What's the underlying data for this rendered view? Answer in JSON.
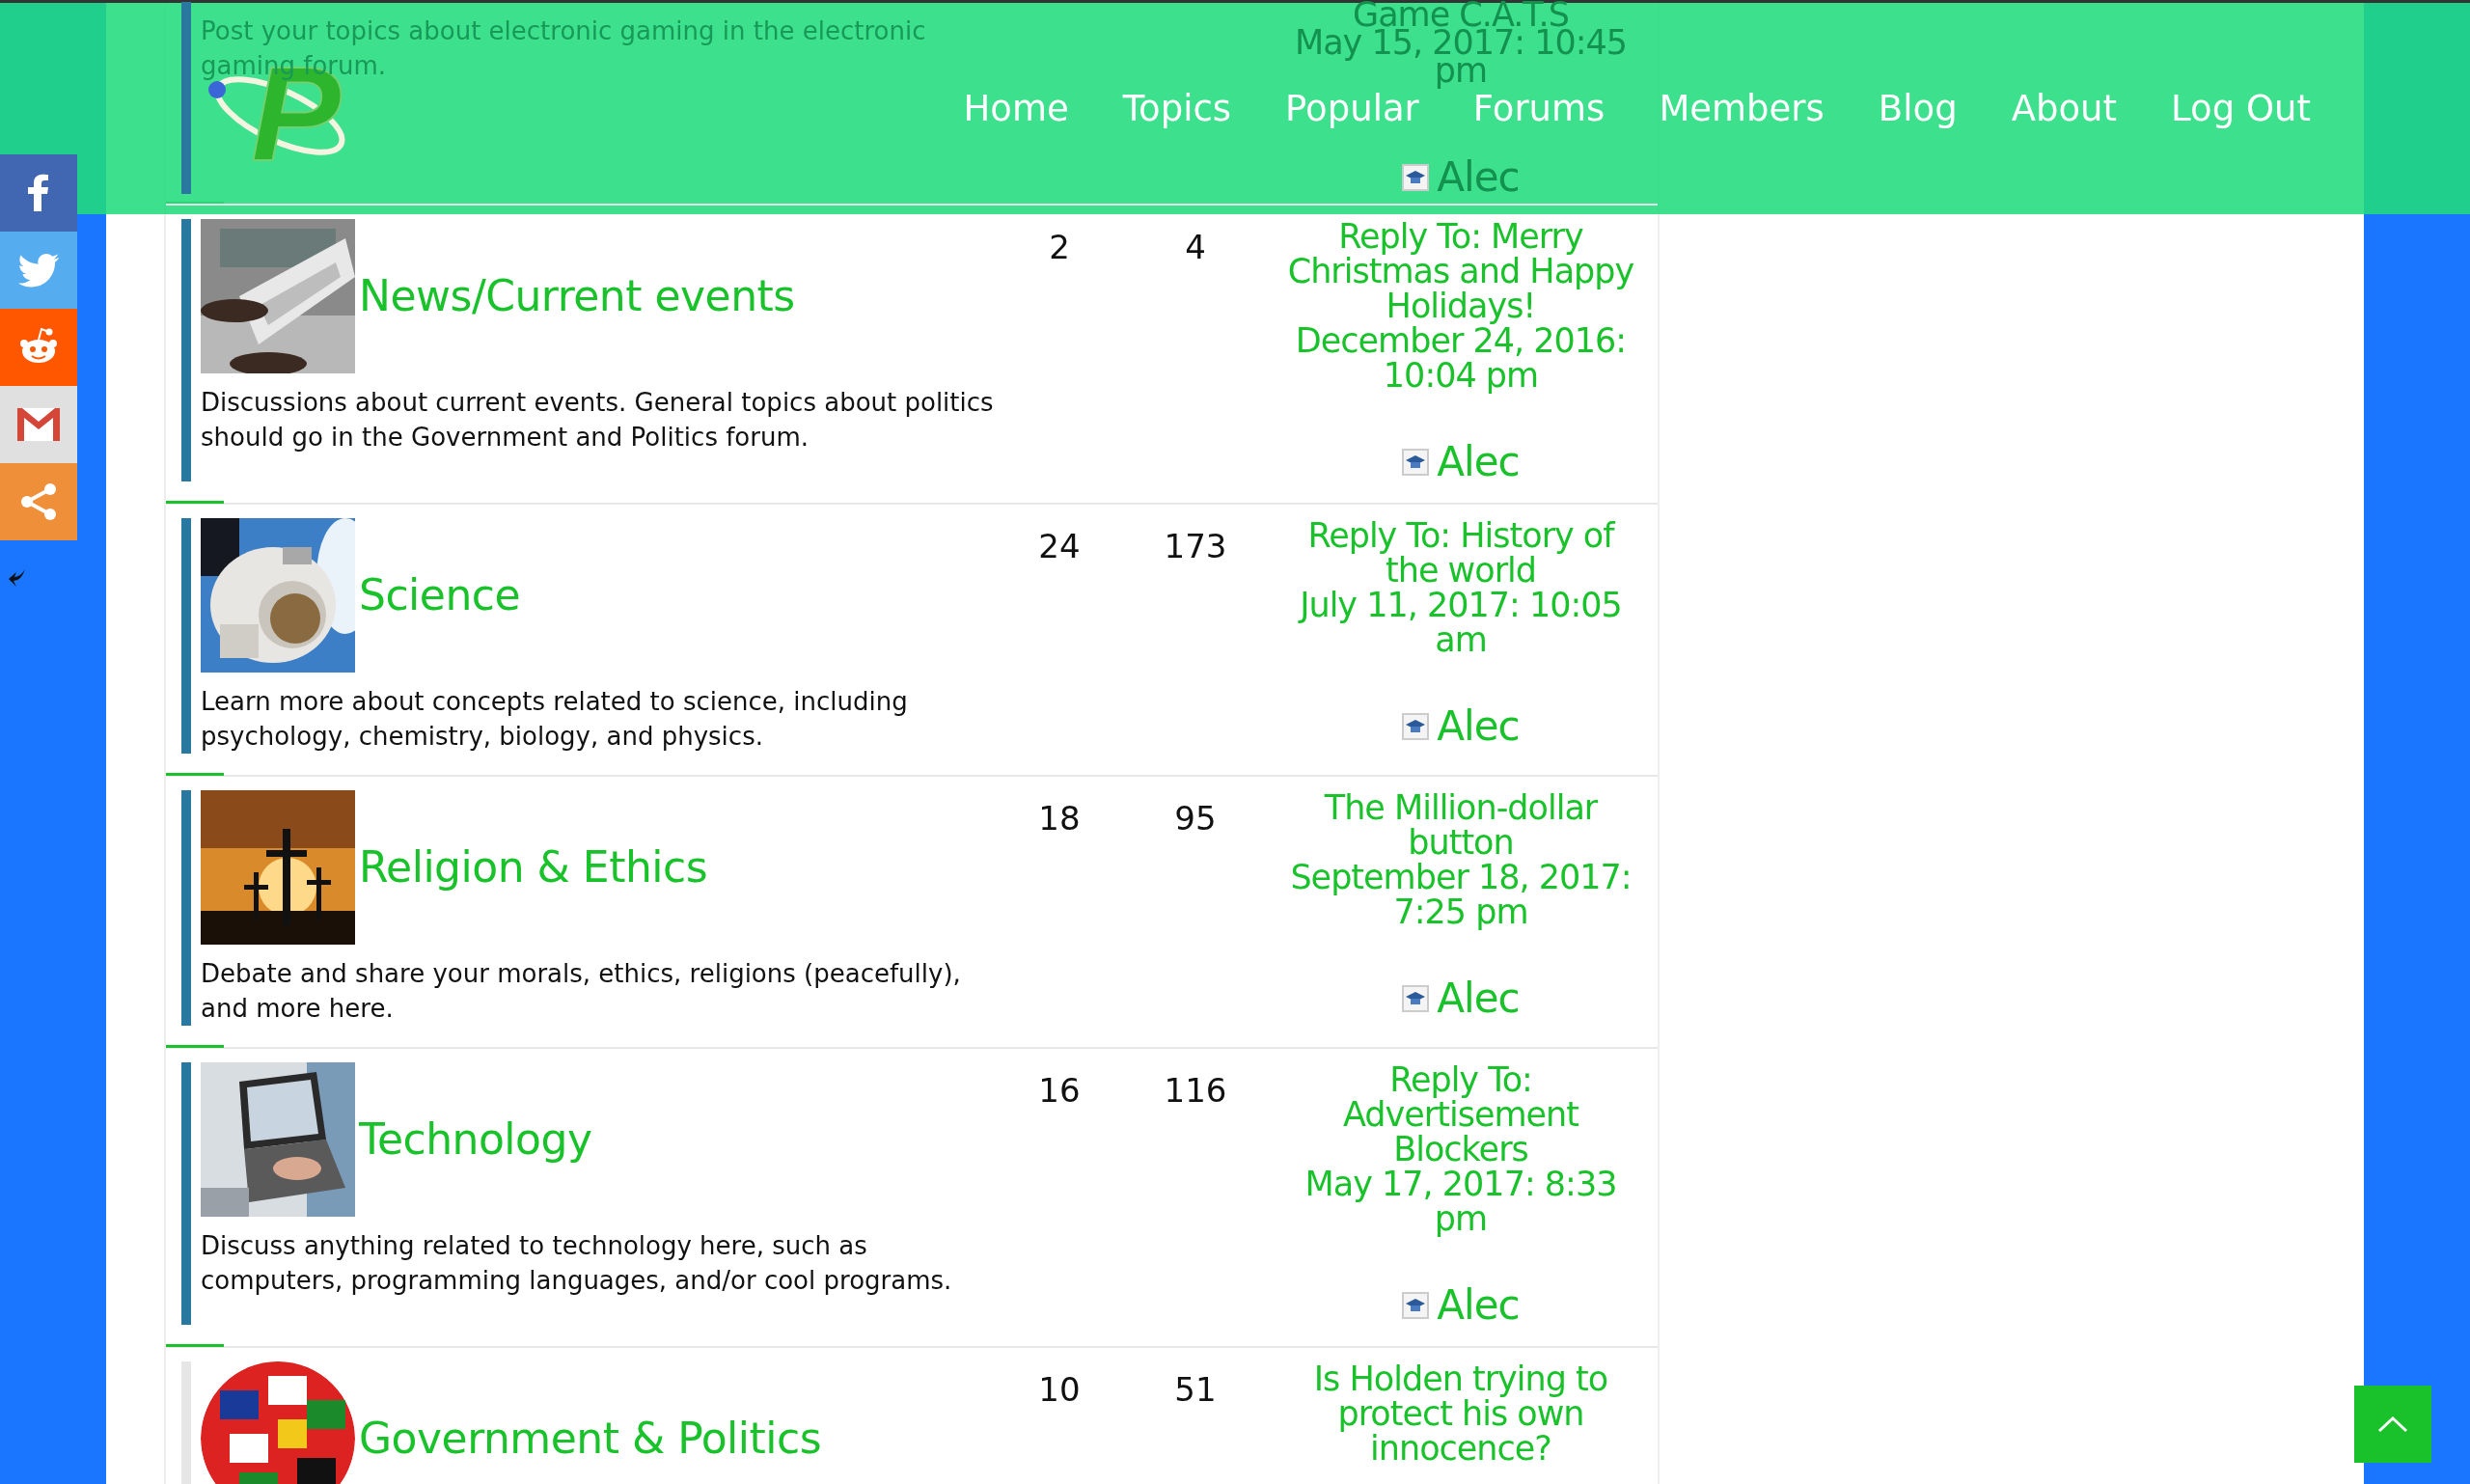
{
  "header": {
    "logo_text": "P",
    "nav": [
      {
        "label": "Home"
      },
      {
        "label": "Topics"
      },
      {
        "label": "Popular"
      },
      {
        "label": "Forums"
      },
      {
        "label": "Members"
      },
      {
        "label": "Blog"
      },
      {
        "label": "About"
      },
      {
        "label": "Log Out"
      }
    ]
  },
  "share_bar": {
    "buttons": [
      {
        "kind": "facebook"
      },
      {
        "kind": "twitter"
      },
      {
        "kind": "reddit"
      },
      {
        "kind": "gmail"
      },
      {
        "kind": "share"
      }
    ]
  },
  "forums": [
    {
      "highlighted": true,
      "description": "Post your topics about electronic gaming in the electronic gaming forum.",
      "freshness": {
        "title": "Game C.A.T.S",
        "date": "May 15, 2017: 10:45 pm",
        "author": "Alec"
      }
    },
    {
      "highlighted": true,
      "title": "News/Current events",
      "description": "Discussions about current events. General topics about politics should go in the Government and Politics forum.",
      "topics": "2",
      "posts": "4",
      "freshness": {
        "title": "Reply To: Merry Christmas and Happy Holidays!",
        "date": "December 24, 2016: 10:04 pm",
        "author": "Alec"
      }
    },
    {
      "highlighted": true,
      "title": "Science",
      "description": "Learn more about concepts related to science, including psychology, chemistry, biology, and physics.",
      "topics": "24",
      "posts": "173",
      "freshness": {
        "title": "Reply To: History of the world",
        "date": "July 11, 2017: 10:05 am",
        "author": "Alec"
      }
    },
    {
      "highlighted": true,
      "title": "Religion & Ethics",
      "description": "Debate and share your morals, ethics, religions (peacefully), and more here.",
      "topics": "18",
      "posts": "95",
      "freshness": {
        "title": "The Million-dollar button",
        "date": "September 18, 2017: 7:25 pm",
        "author": "Alec"
      }
    },
    {
      "highlighted": true,
      "title": "Technology",
      "description": "Discuss anything related to technology here, such as computers, programming languages, and/or cool programs.",
      "topics": "16",
      "posts": "116",
      "freshness": {
        "title": "Reply To: Advertisement Blockers",
        "date": "May 17, 2017: 8:33 pm",
        "author": "Alec"
      }
    },
    {
      "highlighted": false,
      "title": "Government & Politics",
      "topics": "10",
      "posts": "51",
      "freshness": {
        "title": "Is Holden trying to protect his own innocence?"
      }
    }
  ]
}
